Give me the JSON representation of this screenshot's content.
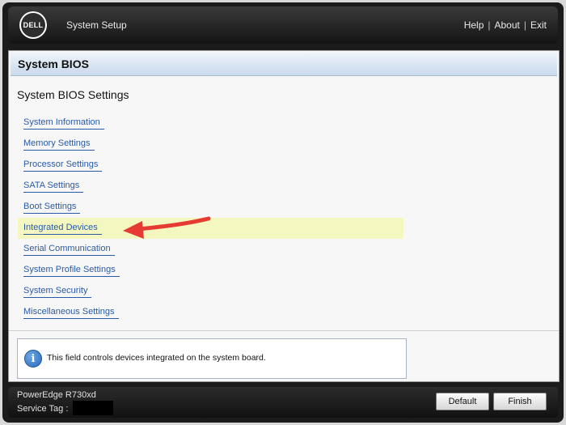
{
  "header": {
    "logo_text": "DELL",
    "app_title": "System Setup",
    "links": {
      "help": "Help",
      "about": "About",
      "exit": "Exit"
    },
    "separator": "|"
  },
  "panel": {
    "section_title": "System BIOS",
    "page_title": "System BIOS Settings",
    "menu": [
      {
        "label": "System Information"
      },
      {
        "label": "Memory Settings"
      },
      {
        "label": "Processor Settings"
      },
      {
        "label": "SATA Settings"
      },
      {
        "label": "Boot Settings"
      },
      {
        "label": "Integrated Devices",
        "highlighted": true
      },
      {
        "label": "Serial Communication"
      },
      {
        "label": "System Profile Settings"
      },
      {
        "label": "System Security"
      },
      {
        "label": "Miscellaneous Settings"
      }
    ],
    "help": {
      "icon": "info-icon",
      "text": "This field controls devices integrated on the system board."
    }
  },
  "footer": {
    "model": "PowerEdge R730xd",
    "service_tag_label": "Service Tag :",
    "buttons": {
      "default": "Default",
      "finish": "Finish"
    }
  },
  "colors": {
    "link": "#2a5aa6",
    "highlight": "#f4f8c0",
    "annotation_arrow": "#e53b33",
    "section_header": "#c9d9ec"
  }
}
